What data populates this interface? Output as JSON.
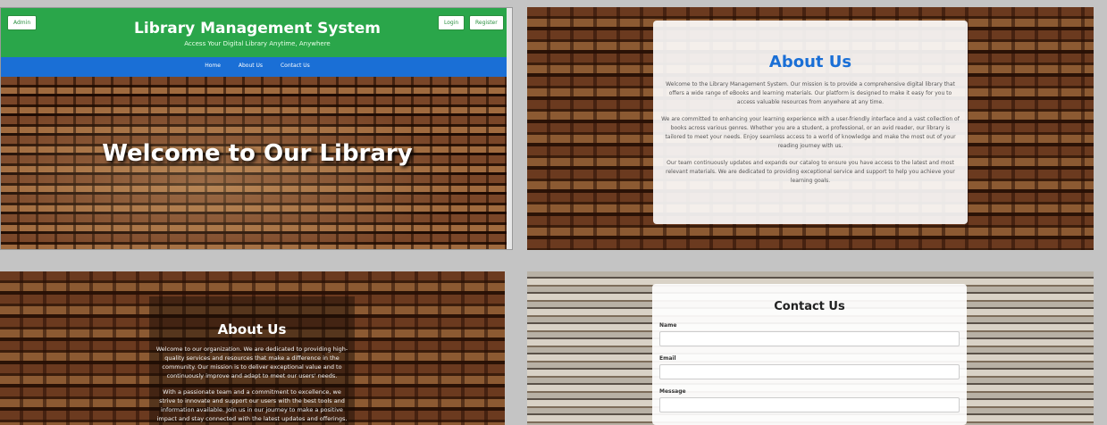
{
  "panel1": {
    "admin_label": "Admin",
    "title": "Library Management System",
    "subtitle": "Access Your Digital Library Anytime, Anywhere",
    "login_label": "Login",
    "register_label": "Register",
    "nav": [
      "Home",
      "About Us",
      "Contact Us"
    ],
    "hero_text": "Welcome to Our Library",
    "colors": {
      "header": "#2aa64a",
      "nav": "#1a6fd6"
    }
  },
  "panel2": {
    "heading": "About Us",
    "paragraphs": [
      "Welcome to the Library Management System. Our mission is to provide a comprehensive digital library that offers a wide range of eBooks and learning materials. Our platform is designed to make it easy for you to access valuable resources from anywhere at any time.",
      "We are committed to enhancing your learning experience with a user-friendly interface and a vast collection of books across various genres. Whether you are a student, a professional, or an avid reader, our library is tailored to meet your needs. Enjoy seamless access to a world of knowledge and make the most out of your reading journey with us.",
      "Our team continuously updates and expands our catalog to ensure you have access to the latest and most relevant materials. We are dedicated to providing exceptional service and support to help you achieve your learning goals."
    ]
  },
  "panel3": {
    "heading": "About Us",
    "paragraphs": [
      "Welcome to our organization. We are dedicated to providing high-quality services and resources that make a difference in the community. Our mission is to deliver exceptional value and to continuously improve and adapt to meet our users' needs.",
      "With a passionate team and a commitment to excellence, we strive to innovate and support our users with the best tools and information available. Join us in our journey to make a positive impact and stay connected with the latest updates and offerings."
    ]
  },
  "panel4": {
    "heading": "Contact Us",
    "name_label": "Name",
    "email_label": "Email",
    "message_label": "Message"
  }
}
